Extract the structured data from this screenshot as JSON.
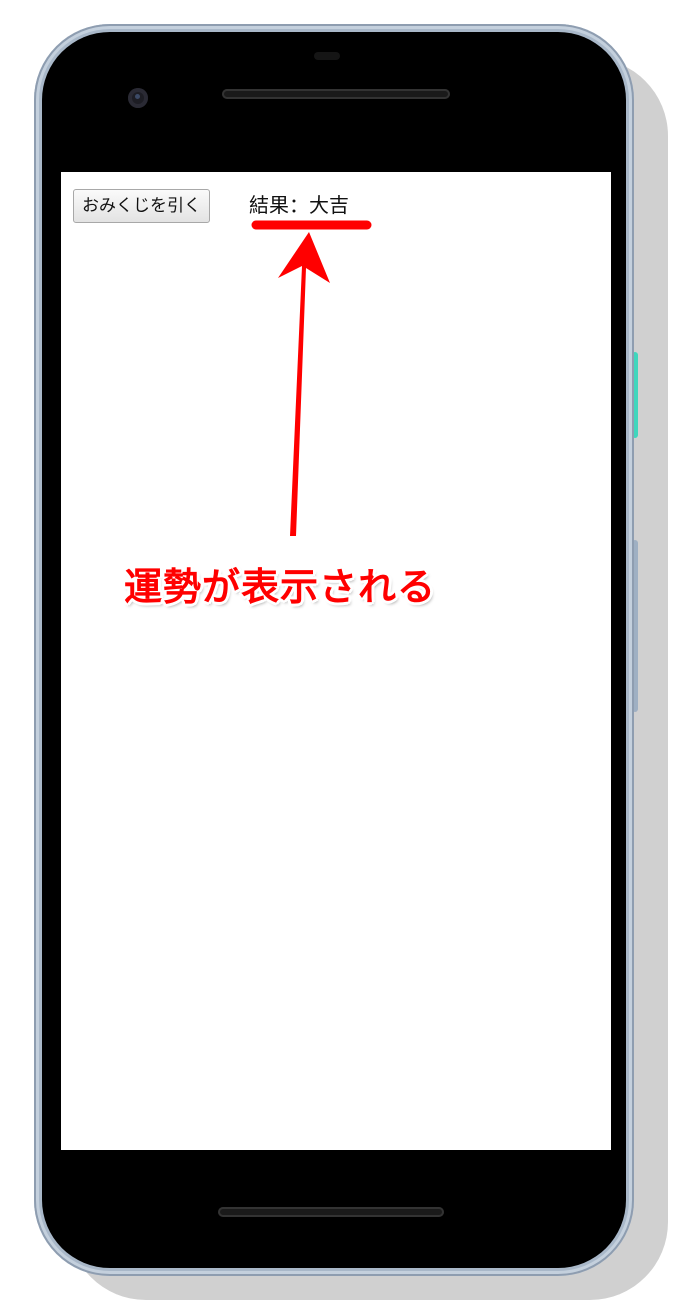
{
  "app": {
    "button_label": "おみくじを引く",
    "result_text": "結果：大吉"
  },
  "annotation": {
    "label": "運勢が表示される",
    "color": "#ff0000"
  },
  "device": {
    "frame_color": "#a9b8c9",
    "accent_button_color": "#3fd6bd"
  }
}
